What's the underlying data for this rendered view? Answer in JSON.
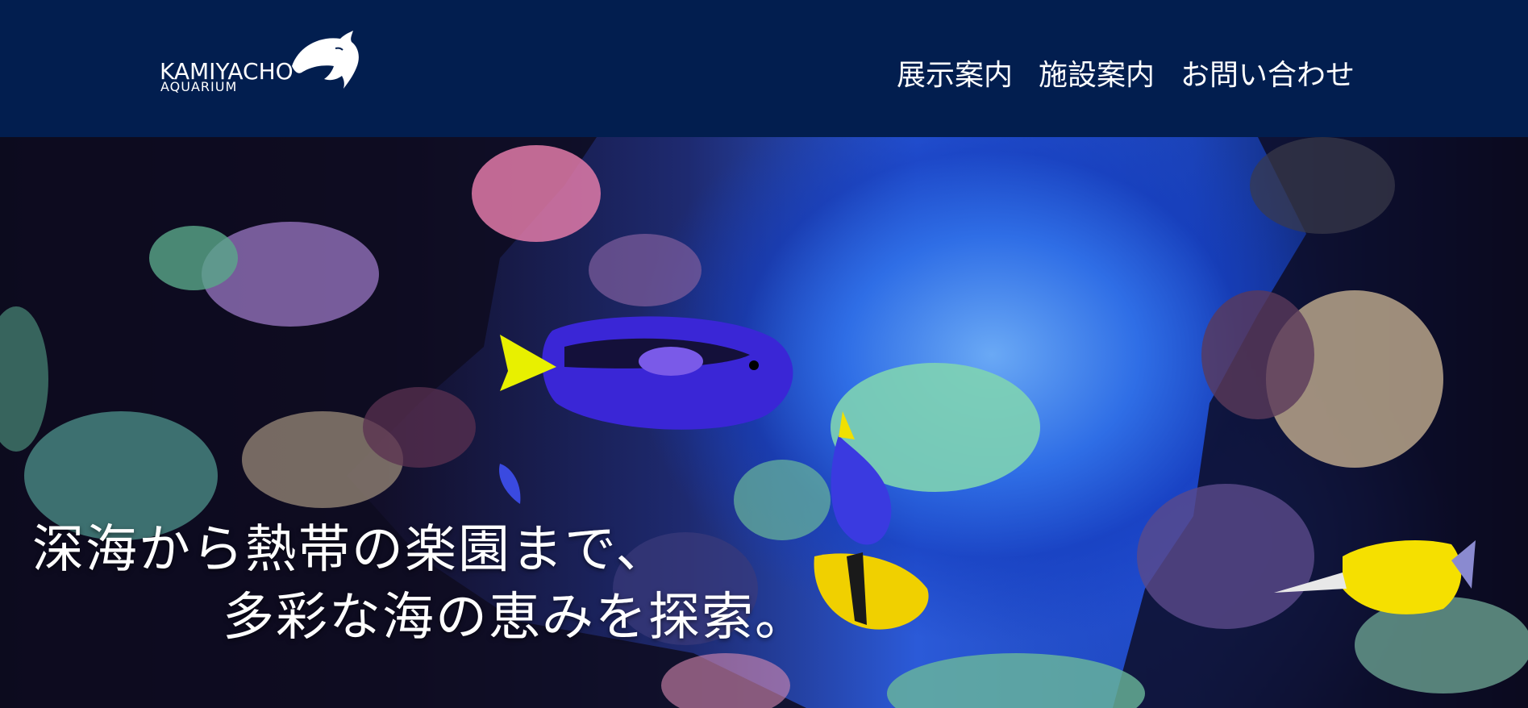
{
  "header": {
    "logo": {
      "name": "KAMIYACHO",
      "sub": "AQUARIUM"
    },
    "nav": [
      {
        "label": "展示案内"
      },
      {
        "label": "施設案内"
      },
      {
        "label": "お問い合わせ"
      }
    ]
  },
  "hero": {
    "headline_line1": "深海から熱帯の楽園まで、",
    "headline_line2": "多彩な海の恵みを探索。"
  },
  "colors": {
    "header_bg": "#021e4f",
    "text": "#ffffff",
    "water_accent": "#2f6ee6"
  },
  "icons": {
    "logo": "dolphin-icon"
  }
}
